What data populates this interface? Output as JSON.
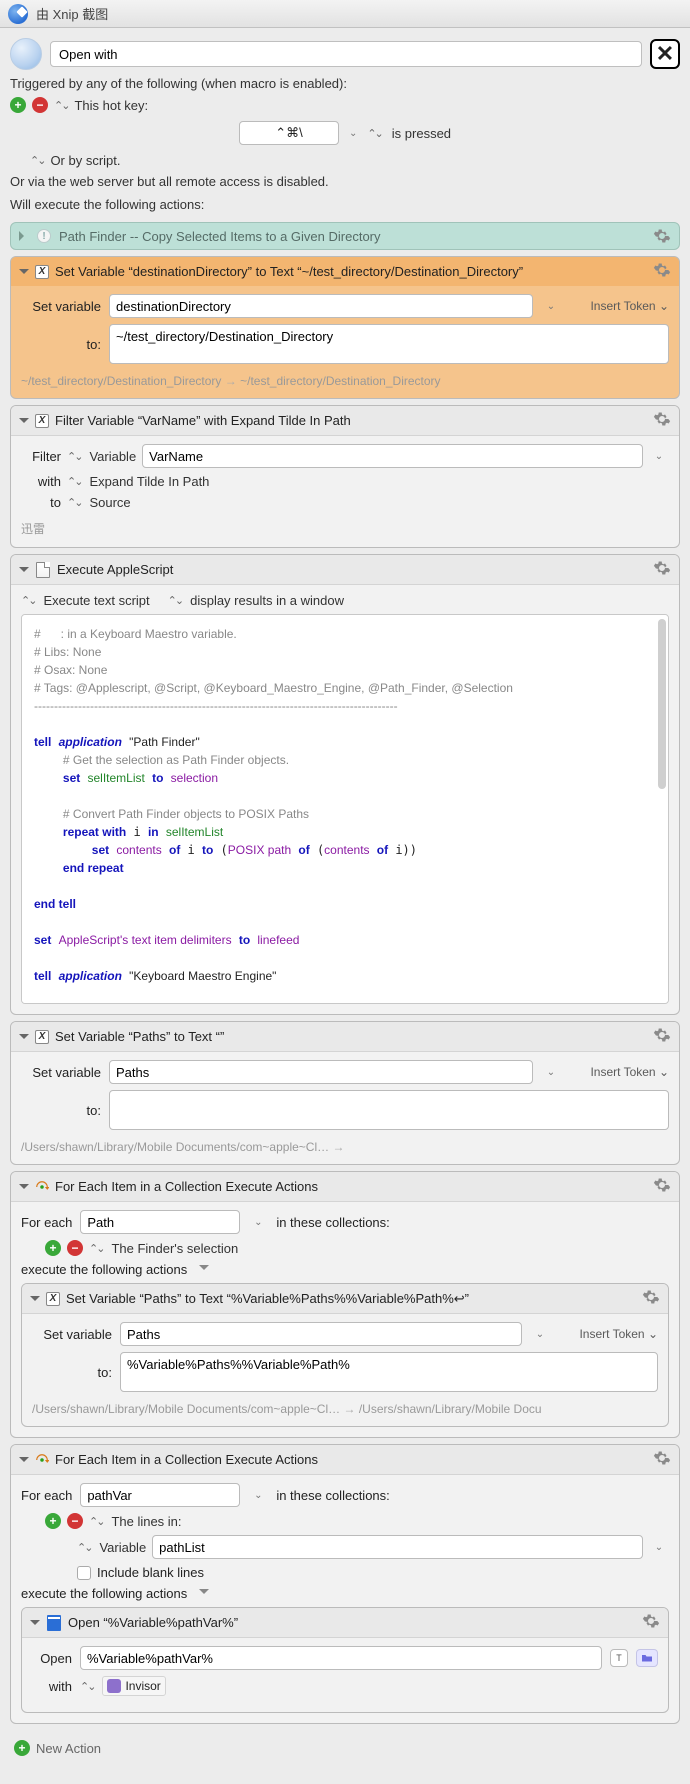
{
  "window": {
    "title": "由 Xnip 截图"
  },
  "macro": {
    "name": "Open with",
    "trigger_header": "Triggered by any of the following (when macro is enabled):",
    "hotkey_label": "This hot key:",
    "hotkey_value": "⌃⌘\\",
    "hotkey_state": "is pressed",
    "or_by_script": "Or by script.",
    "webserver_note": "Or via the web server but all remote access is disabled.",
    "exec_header": "Will execute the following actions:"
  },
  "action_disabled": {
    "title": "Path Finder -- Copy Selected Items to a Given Directory"
  },
  "set_var1": {
    "title": "Set Variable “destinationDirectory” to Text “~/test_directory/Destination_Directory”",
    "set_variable_label": "Set variable",
    "variable": "destinationDirectory",
    "insert_token": "Insert Token",
    "to_label": "to:",
    "to_value": "~/test_directory/Destination_Directory",
    "footer_from": "~/test_directory/Destination_Directory",
    "footer_to": "~/test_directory/Destination_Directory"
  },
  "filter": {
    "title": "Filter Variable “VarName” with Expand Tilde In Path",
    "filter_label": "Filter",
    "filter_target": "Variable",
    "variable": "VarName",
    "with_label": "with",
    "with_value": "Expand Tilde In Path",
    "to_label": "to",
    "to_value": "Source",
    "footer": "迅雷"
  },
  "applescript": {
    "title": "Execute AppleScript",
    "opt1": "Execute text script",
    "opt2": "display results in a window",
    "code_comment1": "#      : in a Keyboard Maestro variable.",
    "code_comment2": "# Libs: None",
    "code_comment3": "# Osax: None",
    "code_comment4": "# Tags: @Applescript, @Script, @Keyboard_Maestro_Engine, @Path_Finder, @Selection",
    "code_dash": "-------------------------------------------------------------------------------------------"
  },
  "set_var2": {
    "title": "Set Variable “Paths” to Text “”",
    "variable": "Paths",
    "to_value": "",
    "footer_from": "/Users/shawn/Library/Mobile Documents/com~apple~Cl…"
  },
  "foreach1": {
    "title": "For Each Item in a Collection Execute Actions",
    "for_each_label": "For each",
    "var": "Path",
    "in_label": "in these collections:",
    "collection": "The Finder's selection",
    "exec_label": "execute the following actions",
    "nested": {
      "title": "Set Variable “Paths” to Text “%Variable%Paths%%Variable%Path%↩”",
      "variable": "Paths",
      "to_value": "%Variable%Paths%%Variable%Path%",
      "footer_from": "/Users/shawn/Library/Mobile Documents/com~apple~Cl…",
      "footer_to": "/Users/shawn/Library/Mobile Docu"
    }
  },
  "foreach2": {
    "title": "For Each Item in a Collection Execute Actions",
    "var": "pathVar",
    "lines_in": "The lines in:",
    "var2_label": "Variable",
    "var2": "pathList",
    "include_blank": "Include blank lines",
    "nested": {
      "title": "Open “%Variable%pathVar%”",
      "open_label": "Open",
      "open_value": "%Variable%pathVar%",
      "with_label": "with",
      "app": "Invisor"
    }
  },
  "labels": {
    "set_variable": "Set variable",
    "insert_token": "Insert Token",
    "to": "to:",
    "new_action": "New Action"
  }
}
